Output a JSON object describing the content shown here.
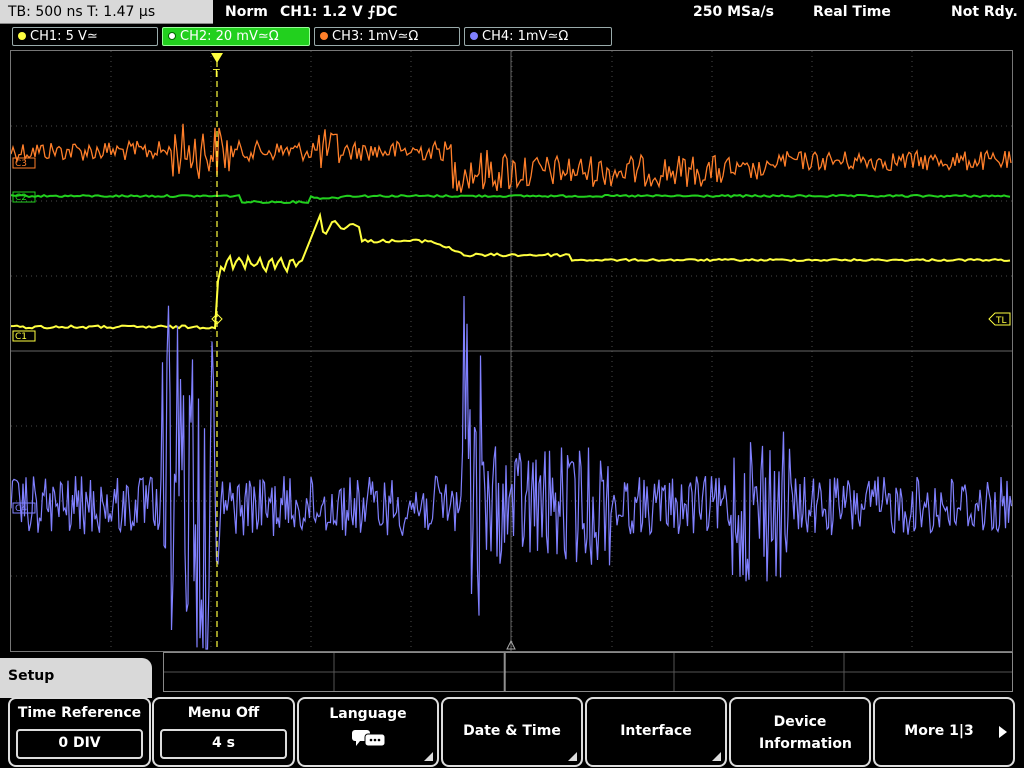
{
  "header": {
    "timebase": "TB: 500 ns   T: 1.47 µs",
    "trigger_mode": "Norm",
    "trigger_info": "CH1: 1.2 V ⨍DC",
    "sample_rate": "250 MSa/s",
    "acq_mode": "Real Time",
    "state": "Not Rdy."
  },
  "channels": [
    {
      "label": "CH1: 5 V≃",
      "color": "#ffff40",
      "active": false
    },
    {
      "label": "CH2: 20 mV≃Ω",
      "color": "#22d01e",
      "active": true
    },
    {
      "label": "CH3: 1mV≃Ω",
      "color": "#ff7f2a",
      "active": false
    },
    {
      "label": "CH4: 1mV≃Ω",
      "color": "#8080ff",
      "active": false
    }
  ],
  "markers": {
    "ch3": "C3",
    "ch2": "C2",
    "ch1": "C1",
    "ch4": "C4",
    "trigger_level": "TL",
    "trigger_pos": "T"
  },
  "menu": {
    "title": "Setup",
    "softkeys": [
      {
        "label": "Time Reference",
        "value": "0 DIV"
      },
      {
        "label": "Menu Off",
        "value": "4 s"
      },
      {
        "label": "Language",
        "icon": "speech-bubble-icon"
      },
      {
        "label": "Date & Time"
      },
      {
        "label": "Interface"
      },
      {
        "label": "Device Information"
      },
      {
        "label": "More 1|3"
      }
    ]
  }
}
